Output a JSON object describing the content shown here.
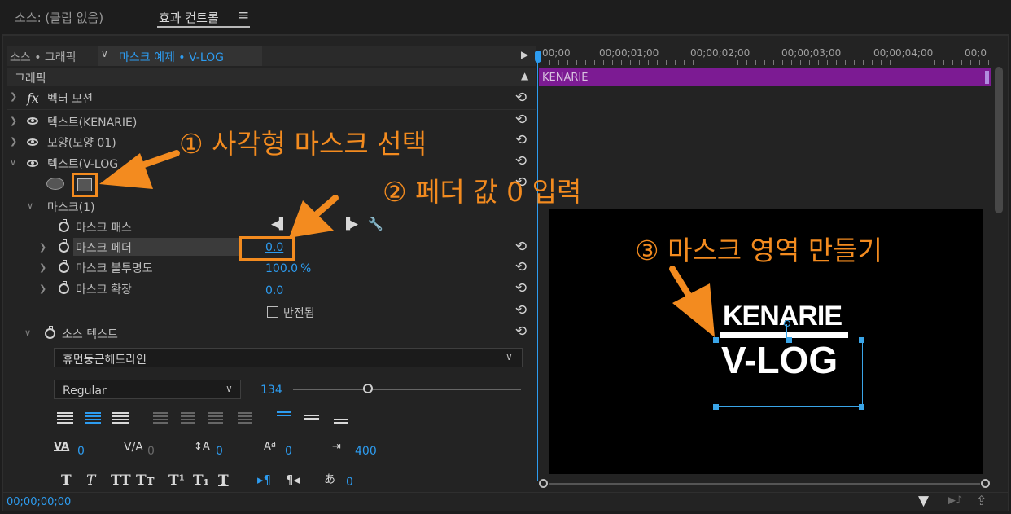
{
  "header": {
    "tab_source": "소스: (클립 없음)",
    "tab_effect_controls": "효과 컨트롤",
    "menu_icon": "≡"
  },
  "source_bar": {
    "source_label": "소스 • 그래픽",
    "sequence_label": "마스크 예제 • V-LOG"
  },
  "timeline": {
    "ticks": [
      "00;00",
      "00;00;01;00",
      "00;00;02;00",
      "00;00;03;00",
      "00;00;04;00",
      "00;0"
    ],
    "clip_label": "KENARIE"
  },
  "graphics_section": "그래픽",
  "layers": [
    {
      "label": "벡터 모션"
    },
    {
      "label": "텍스트(KENARIE)"
    },
    {
      "label": "모양(모양 01)"
    },
    {
      "label": "텍스트(V-LOG"
    }
  ],
  "mask": {
    "title": "마스크(1)",
    "path_label": "마스크 패스",
    "feather_label": "마스크 페더",
    "feather_value": "0.0",
    "opacity_label": "마스크 불투명도",
    "opacity_value": "100.0",
    "opacity_unit": "%",
    "expansion_label": "마스크 확장",
    "expansion_value": "0.0",
    "inverted_label": "반전됨"
  },
  "source_text": {
    "title": "소스 텍스트",
    "font_name": "휴먼둥근헤드라인",
    "font_style": "Regular",
    "font_size": "134",
    "kerning": "0",
    "tracking": "0",
    "leading": "0",
    "baseline": "0",
    "tab_width": "400",
    "tsume": "0"
  },
  "text_buttons": [
    "T",
    "T",
    "TT",
    "Tт",
    "T¹",
    "T₁",
    "T"
  ],
  "annotations": {
    "step1": "① 사각형 마스크 선택",
    "step2": "② 페더 값 0 입력",
    "step3": "③ 마스크 영역 만들기"
  },
  "preview": {
    "line1": "KENARIE",
    "line2": "V-LOG"
  },
  "footer": {
    "timecode": "00;00;00;00"
  },
  "colors": {
    "accent_blue": "#2d9cf0",
    "annotation_orange": "#f38b1f",
    "clip_purple": "#7c1b93"
  }
}
